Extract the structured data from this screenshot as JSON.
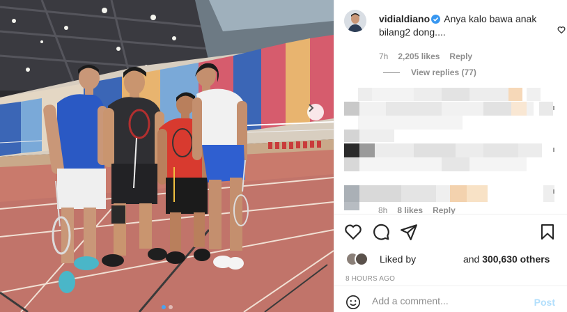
{
  "comment": {
    "username": "vidialdiano",
    "text": "Anya kalo bawa anak bilang2 dong....",
    "time": "7h",
    "likes": "2,205 likes",
    "reply": "Reply"
  },
  "view_replies": "View replies (77)",
  "blurred_comment_meta": {
    "time": "8h",
    "likes": "8 likes",
    "reply": "Reply"
  },
  "post": {
    "liked_by_label": "Liked by",
    "and_label": "and",
    "likes_count": "300,630 others",
    "time_ago": "8 HOURS AGO"
  },
  "add_comment": {
    "placeholder": "Add a comment...",
    "post_label": "Post"
  },
  "colors": {
    "post_button_disabled": "#b2dffc",
    "verified_badge": "#3897f0",
    "secondary_text": "#8e8e8e",
    "carousel_dot_active": "#4aa3f0"
  },
  "icons": {
    "like": "heart-icon",
    "comment": "comment-icon",
    "share": "paper-plane-icon",
    "save": "bookmark-icon",
    "emoji": "smiley-icon",
    "carousel_next": "chevron-right-icon"
  },
  "carousel": {
    "slide_count": 2,
    "active_index": 0
  }
}
